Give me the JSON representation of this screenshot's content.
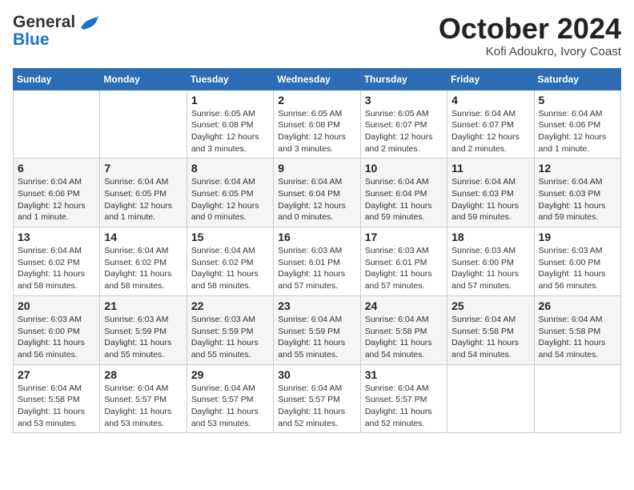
{
  "header": {
    "logo_general": "General",
    "logo_blue": "Blue",
    "month_title": "October 2024",
    "location": "Kofi Adoukro, Ivory Coast"
  },
  "weekdays": [
    "Sunday",
    "Monday",
    "Tuesday",
    "Wednesday",
    "Thursday",
    "Friday",
    "Saturday"
  ],
  "weeks": [
    [
      {
        "day": "",
        "info": ""
      },
      {
        "day": "",
        "info": ""
      },
      {
        "day": "1",
        "info": "Sunrise: 6:05 AM\nSunset: 6:08 PM\nDaylight: 12 hours\nand 3 minutes."
      },
      {
        "day": "2",
        "info": "Sunrise: 6:05 AM\nSunset: 6:08 PM\nDaylight: 12 hours\nand 3 minutes."
      },
      {
        "day": "3",
        "info": "Sunrise: 6:05 AM\nSunset: 6:07 PM\nDaylight: 12 hours\nand 2 minutes."
      },
      {
        "day": "4",
        "info": "Sunrise: 6:04 AM\nSunset: 6:07 PM\nDaylight: 12 hours\nand 2 minutes."
      },
      {
        "day": "5",
        "info": "Sunrise: 6:04 AM\nSunset: 6:06 PM\nDaylight: 12 hours\nand 1 minute."
      }
    ],
    [
      {
        "day": "6",
        "info": "Sunrise: 6:04 AM\nSunset: 6:06 PM\nDaylight: 12 hours\nand 1 minute."
      },
      {
        "day": "7",
        "info": "Sunrise: 6:04 AM\nSunset: 6:05 PM\nDaylight: 12 hours\nand 1 minute."
      },
      {
        "day": "8",
        "info": "Sunrise: 6:04 AM\nSunset: 6:05 PM\nDaylight: 12 hours\nand 0 minutes."
      },
      {
        "day": "9",
        "info": "Sunrise: 6:04 AM\nSunset: 6:04 PM\nDaylight: 12 hours\nand 0 minutes."
      },
      {
        "day": "10",
        "info": "Sunrise: 6:04 AM\nSunset: 6:04 PM\nDaylight: 11 hours\nand 59 minutes."
      },
      {
        "day": "11",
        "info": "Sunrise: 6:04 AM\nSunset: 6:03 PM\nDaylight: 11 hours\nand 59 minutes."
      },
      {
        "day": "12",
        "info": "Sunrise: 6:04 AM\nSunset: 6:03 PM\nDaylight: 11 hours\nand 59 minutes."
      }
    ],
    [
      {
        "day": "13",
        "info": "Sunrise: 6:04 AM\nSunset: 6:02 PM\nDaylight: 11 hours\nand 58 minutes."
      },
      {
        "day": "14",
        "info": "Sunrise: 6:04 AM\nSunset: 6:02 PM\nDaylight: 11 hours\nand 58 minutes."
      },
      {
        "day": "15",
        "info": "Sunrise: 6:04 AM\nSunset: 6:02 PM\nDaylight: 11 hours\nand 58 minutes."
      },
      {
        "day": "16",
        "info": "Sunrise: 6:03 AM\nSunset: 6:01 PM\nDaylight: 11 hours\nand 57 minutes."
      },
      {
        "day": "17",
        "info": "Sunrise: 6:03 AM\nSunset: 6:01 PM\nDaylight: 11 hours\nand 57 minutes."
      },
      {
        "day": "18",
        "info": "Sunrise: 6:03 AM\nSunset: 6:00 PM\nDaylight: 11 hours\nand 57 minutes."
      },
      {
        "day": "19",
        "info": "Sunrise: 6:03 AM\nSunset: 6:00 PM\nDaylight: 11 hours\nand 56 minutes."
      }
    ],
    [
      {
        "day": "20",
        "info": "Sunrise: 6:03 AM\nSunset: 6:00 PM\nDaylight: 11 hours\nand 56 minutes."
      },
      {
        "day": "21",
        "info": "Sunrise: 6:03 AM\nSunset: 5:59 PM\nDaylight: 11 hours\nand 55 minutes."
      },
      {
        "day": "22",
        "info": "Sunrise: 6:03 AM\nSunset: 5:59 PM\nDaylight: 11 hours\nand 55 minutes."
      },
      {
        "day": "23",
        "info": "Sunrise: 6:04 AM\nSunset: 5:59 PM\nDaylight: 11 hours\nand 55 minutes."
      },
      {
        "day": "24",
        "info": "Sunrise: 6:04 AM\nSunset: 5:58 PM\nDaylight: 11 hours\nand 54 minutes."
      },
      {
        "day": "25",
        "info": "Sunrise: 6:04 AM\nSunset: 5:58 PM\nDaylight: 11 hours\nand 54 minutes."
      },
      {
        "day": "26",
        "info": "Sunrise: 6:04 AM\nSunset: 5:58 PM\nDaylight: 11 hours\nand 54 minutes."
      }
    ],
    [
      {
        "day": "27",
        "info": "Sunrise: 6:04 AM\nSunset: 5:58 PM\nDaylight: 11 hours\nand 53 minutes."
      },
      {
        "day": "28",
        "info": "Sunrise: 6:04 AM\nSunset: 5:57 PM\nDaylight: 11 hours\nand 53 minutes."
      },
      {
        "day": "29",
        "info": "Sunrise: 6:04 AM\nSunset: 5:57 PM\nDaylight: 11 hours\nand 53 minutes."
      },
      {
        "day": "30",
        "info": "Sunrise: 6:04 AM\nSunset: 5:57 PM\nDaylight: 11 hours\nand 52 minutes."
      },
      {
        "day": "31",
        "info": "Sunrise: 6:04 AM\nSunset: 5:57 PM\nDaylight: 11 hours\nand 52 minutes."
      },
      {
        "day": "",
        "info": ""
      },
      {
        "day": "",
        "info": ""
      }
    ]
  ]
}
